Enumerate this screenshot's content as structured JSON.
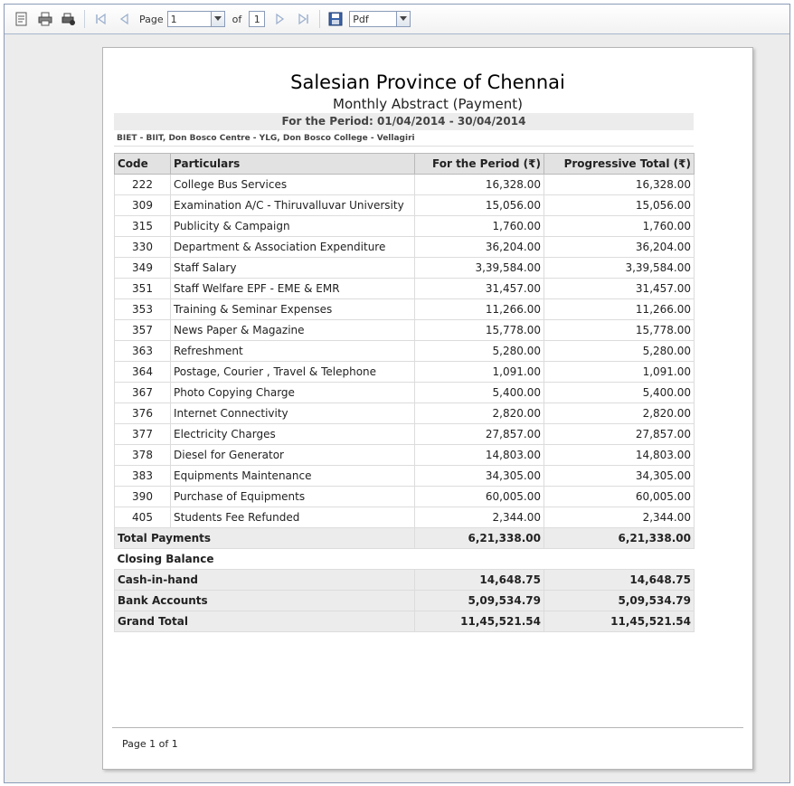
{
  "toolbar": {
    "page_label": "Page",
    "page_value": "1",
    "of_label": "of",
    "total_pages": "1",
    "format_value": "Pdf"
  },
  "report": {
    "title": "Salesian Province of Chennai",
    "subtitle": "Monthly Abstract (Payment)",
    "period": "For the Period: 01/04/2014 - 30/04/2014",
    "unit": "BIET - BIIT, Don Bosco Centre - YLG, Don Bosco College - Vellagiri",
    "headers": {
      "code": "Code",
      "particulars": "Particulars",
      "period": "For the Period (₹)",
      "progressive": "Progressive Total (₹)"
    },
    "rows": [
      {
        "code": "222",
        "particulars": "College Bus Services",
        "period": "16,328.00",
        "progressive": "16,328.00"
      },
      {
        "code": "309",
        "particulars": "Examination  A/C - Thiruvalluvar University",
        "period": "15,056.00",
        "progressive": "15,056.00"
      },
      {
        "code": "315",
        "particulars": "Publicity & Campaign",
        "period": "1,760.00",
        "progressive": "1,760.00"
      },
      {
        "code": "330",
        "particulars": "Department & Association  Expenditure",
        "period": "36,204.00",
        "progressive": "36,204.00"
      },
      {
        "code": "349",
        "particulars": "Staff  Salary",
        "period": "3,39,584.00",
        "progressive": "3,39,584.00"
      },
      {
        "code": "351",
        "particulars": "Staff Welfare EPF - EME & EMR",
        "period": "31,457.00",
        "progressive": "31,457.00"
      },
      {
        "code": "353",
        "particulars": "Training & Seminar Expenses",
        "period": "11,266.00",
        "progressive": "11,266.00"
      },
      {
        "code": "357",
        "particulars": "News Paper & Magazine",
        "period": "15,778.00",
        "progressive": "15,778.00"
      },
      {
        "code": "363",
        "particulars": "Refreshment",
        "period": "5,280.00",
        "progressive": "5,280.00"
      },
      {
        "code": "364",
        "particulars": "Postage, Courier , Travel & Telephone",
        "period": "1,091.00",
        "progressive": "1,091.00"
      },
      {
        "code": "367",
        "particulars": "Photo Copying Charge",
        "period": "5,400.00",
        "progressive": "5,400.00"
      },
      {
        "code": "376",
        "particulars": "Internet Connectivity",
        "period": "2,820.00",
        "progressive": "2,820.00"
      },
      {
        "code": "377",
        "particulars": "Electricity Charges",
        "period": "27,857.00",
        "progressive": "27,857.00"
      },
      {
        "code": "378",
        "particulars": "Diesel for Generator",
        "period": "14,803.00",
        "progressive": "14,803.00"
      },
      {
        "code": "383",
        "particulars": "Equipments Maintenance",
        "period": "34,305.00",
        "progressive": "34,305.00"
      },
      {
        "code": "390",
        "particulars": "Purchase of Equipments",
        "period": "60,005.00",
        "progressive": "60,005.00"
      },
      {
        "code": "405",
        "particulars": "Students Fee Refunded",
        "period": "2,344.00",
        "progressive": "2,344.00"
      }
    ],
    "total_payments": {
      "label": "Total Payments",
      "period": "6,21,338.00",
      "progressive": "6,21,338.00"
    },
    "closing_label": "Closing Balance",
    "cash": {
      "label": "Cash-in-hand",
      "period": "14,648.75",
      "progressive": "14,648.75"
    },
    "bank": {
      "label": "Bank Accounts",
      "period": "5,09,534.79",
      "progressive": "5,09,534.79"
    },
    "grand": {
      "label": "Grand Total",
      "period": "11,45,521.54",
      "progressive": "11,45,521.54"
    },
    "footer": "Page 1 of 1"
  }
}
